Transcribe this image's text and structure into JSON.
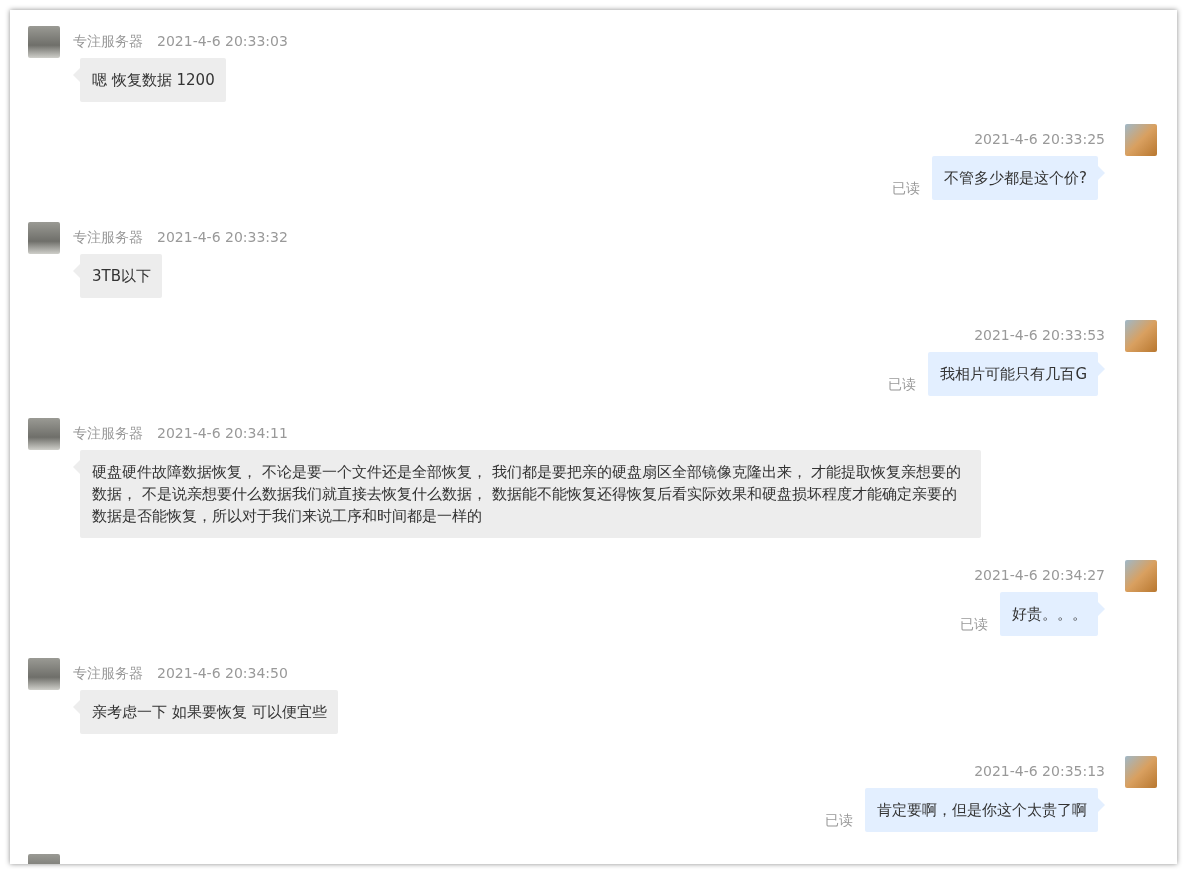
{
  "messages": [
    {
      "kind": "incoming",
      "sender": "专注服务器",
      "time": "2021-4-6 20:33:03",
      "text": "嗯 恢复数据 1200"
    },
    {
      "kind": "outgoing",
      "time": "2021-4-6 20:33:25",
      "text": "不管多少都是这个价?",
      "status": "已读"
    },
    {
      "kind": "incoming",
      "sender": "专注服务器",
      "time": "2021-4-6 20:33:32",
      "text": "3TB以下"
    },
    {
      "kind": "outgoing",
      "time": "2021-4-6 20:33:53",
      "text": "我相片可能只有几百G",
      "status": "已读"
    },
    {
      "kind": "incoming",
      "sender": "专注服务器",
      "time": "2021-4-6 20:34:11",
      "text": "硬盘硬件故障数据恢复， 不论是要一个文件还是全部恢复， 我们都是要把亲的硬盘扇区全部镜像克隆出来， 才能提取恢复亲想要的数据， 不是说亲想要什么数据我们就直接去恢复什么数据， 数据能不能恢复还得恢复后看实际效果和硬盘损坏程度才能确定亲要的数据是否能恢复，所以对于我们来说工序和时间都是一样的"
    },
    {
      "kind": "outgoing",
      "time": "2021-4-6 20:34:27",
      "text": "好贵。。。",
      "status": "已读"
    },
    {
      "kind": "incoming",
      "sender": "专注服务器",
      "time": "2021-4-6 20:34:50",
      "text": "亲考虑一下 如果要恢复 可以便宜些"
    },
    {
      "kind": "outgoing",
      "time": "2021-4-6 20:35:13",
      "text": "肯定要啊，但是你这个太贵了啊",
      "status": "已读"
    },
    {
      "kind": "cut_off"
    }
  ]
}
